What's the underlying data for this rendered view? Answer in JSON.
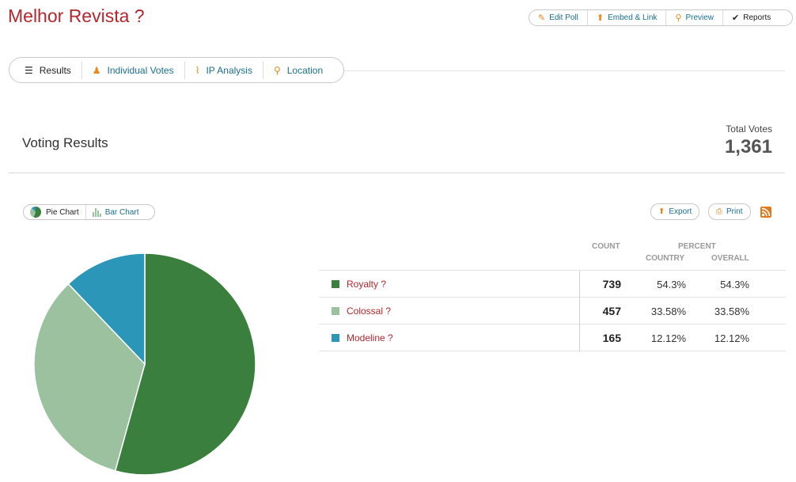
{
  "poll": {
    "title": "Melhor Revista ?"
  },
  "top_actions": [
    {
      "label": "Edit Poll",
      "icon": "pencil-icon"
    },
    {
      "label": "Embed & Link",
      "icon": "arrow-up-icon"
    },
    {
      "label": "Preview",
      "icon": "magnifier-icon"
    },
    {
      "label": "Reports",
      "icon": "checkmark-icon"
    }
  ],
  "tabs": [
    {
      "label": "Results",
      "icon": "list-icon",
      "active": true
    },
    {
      "label": "Individual Votes",
      "icon": "person-icon",
      "active": false
    },
    {
      "label": "IP Analysis",
      "icon": "line-chart-icon",
      "active": false
    },
    {
      "label": "Location",
      "icon": "map-pin-icon",
      "active": false
    }
  ],
  "summary": {
    "section_title": "Voting Results",
    "total_label": "Total Votes",
    "total_value": "1,361"
  },
  "chart_toggle": {
    "pie_label": "Pie Chart",
    "bar_label": "Bar Chart"
  },
  "actions": {
    "export_label": "Export",
    "print_label": "Print"
  },
  "table": {
    "count_header": "COUNT",
    "percent_header": "PERCENT",
    "country_header": "COUNTRY",
    "overall_header": "OVERALL",
    "rows": [
      {
        "name": "Royalty ?",
        "count": "739",
        "country": "54.3%",
        "overall": "54.3%",
        "color": "#3a7f3e"
      },
      {
        "name": "Colossal ?",
        "count": "457",
        "country": "33.58%",
        "overall": "33.58%",
        "color": "#9cc19f"
      },
      {
        "name": "Modeline ?",
        "count": "165",
        "country": "12.12%",
        "overall": "12.12%",
        "color": "#2b96b8"
      }
    ]
  },
  "chart_data": {
    "type": "pie",
    "categories": [
      "Royalty ?",
      "Colossal ?",
      "Modeline ?"
    ],
    "values": [
      739,
      457,
      165
    ],
    "colors": [
      "#3a7f3e",
      "#9cc19f",
      "#2b96b8"
    ]
  }
}
